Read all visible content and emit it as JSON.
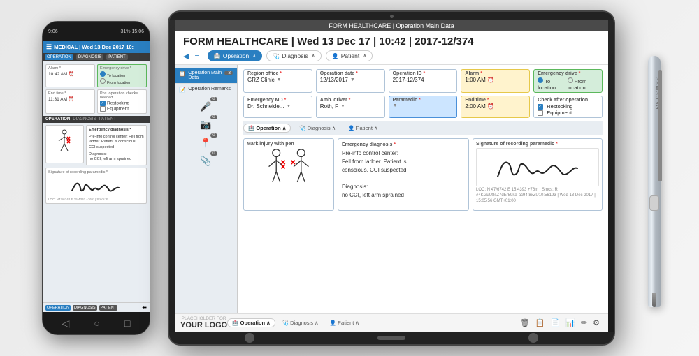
{
  "scene": {
    "background": "#f0f0f0"
  },
  "phone": {
    "status_left": "9:06",
    "status_right": "31% 15:06",
    "header_title": "MEDICAL | Wed 13 Dec 2017 10:",
    "nav_tabs": [
      "OPERATION",
      "DIAGNOSIS",
      "PATIENT"
    ],
    "alarm_label": "Alarm *",
    "alarm_time": "10:42 AM",
    "emergency_label": "Emergency drive *",
    "emergency_to": "To location",
    "emergency_from": "From location",
    "end_time_label": "End time *",
    "end_time": "11:31 AM",
    "post_op_label": "Pos. operation checks needed",
    "restocking": "Restocking",
    "equipment": "Equipment",
    "section2_tabs": [
      "OPERATION",
      "DIAGNOSIS",
      "PATIENT"
    ],
    "injury_label": "Mark injury with pen",
    "diag_label": "Emergency diagnosis *",
    "diag_text": "Pre-info control center: Fell from ladder. Patient is conscious, CCI suspected\n\nDiagnosis:\nno CCI, left arm sprained",
    "sig_label": "Signature of recording paramedic *",
    "footer_tabs": [
      "OPERATION",
      "DIAGNOSIS",
      "PATIENT"
    ]
  },
  "tablet": {
    "title_bar": "FORM HEALTHCARE | Operation Main Data",
    "main_title": "FORM HEALTHCARE | Wed 13 Dec 17 | 10:42 | 2017-12/374",
    "nav_tabs": [
      "Operation",
      "Diagnosis",
      "Patient"
    ],
    "sidebar_items": [
      {
        "label": "Operation Main Data",
        "active": true,
        "badge": "-3"
      },
      {
        "label": "Operation Remarks",
        "active": false,
        "badge": ""
      }
    ],
    "sidebar_icons": [
      "📋",
      "📝",
      "🎤",
      "📷",
      "📎"
    ],
    "fields": {
      "region_office": {
        "label": "Region office *",
        "value": "GRZ Clinic"
      },
      "operation_date": {
        "label": "Operation date *",
        "value": "12/13/2017"
      },
      "operation_id": {
        "label": "Operation ID *",
        "value": "2017-12/374"
      },
      "alarm": {
        "label": "Alarm *",
        "value": "1:00 AM"
      },
      "emergency_drive": {
        "label": "Emergency drive *",
        "value": ""
      },
      "emergency_md": {
        "label": "Emergency MD *",
        "value": "Dr. Schneide..."
      },
      "amb_driver": {
        "label": "Amb. driver *",
        "value": "Roth, F"
      },
      "paramedic": {
        "label": "Paramedic *",
        "value": ""
      },
      "end_time": {
        "label": "End time *",
        "value": "2:00 AM"
      },
      "check_after": {
        "label": "Check after operation",
        "value": "Restocking"
      }
    },
    "emergency_radio": {
      "to": "To location",
      "from": "From location"
    },
    "section2_tabs": [
      "Operation",
      "Diagnosis",
      "Patient"
    ],
    "injury_label": "Mark injury with pen",
    "diag_label": "Emergency diagnosis *",
    "diag_text": "Pre-info control center: Fell from ladder. Patient is conscious, CCI suspected\n\nDiagnosis:\nno CCI, left arm sprained",
    "sig_label": "Signature of recording paramedic *",
    "logo_placeholder": "PLACEHOLDER FOR\nYOUR LOGO",
    "bottom_tabs": [
      "Operation",
      "Diagnosis",
      "Patient"
    ],
    "icon_bar": [
      "🗑",
      "📋",
      "📄",
      "📊",
      "✏",
      "⚙"
    ]
  }
}
